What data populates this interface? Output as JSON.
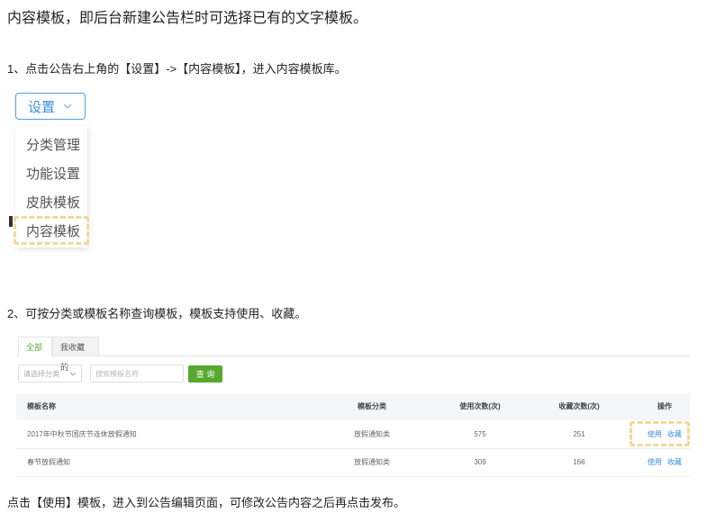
{
  "intro": "内容模板，即后台新建公告栏时可选择已有的文字模板。",
  "step1": "1、点击公告右上角的【设置】->【内容模板】，进入内容模板库。",
  "settings": {
    "button_label": "设置",
    "menu": [
      "分类管理",
      "功能设置",
      "皮肤模板",
      "内容模板"
    ]
  },
  "step2": "2、可按分类或模板名称查询模板，模板支持使用、收藏。",
  "library": {
    "tabs": [
      "全部",
      "我收藏的"
    ],
    "category_select_placeholder": "请选择分类",
    "search_placeholder": "搜索模板名称",
    "query_button": "查 询",
    "columns": [
      "模板名称",
      "模板分类",
      "使用次数(次)",
      "收藏次数(次)",
      "操作"
    ],
    "rows": [
      {
        "name": "2017年中秋节国庆节连休放假通知",
        "category": "放假通知类",
        "uses": "575",
        "favorites": "251",
        "use_link": "使用",
        "fav_link": "收藏"
      },
      {
        "name": "春节放假通知",
        "category": "放假通知类",
        "uses": "309",
        "favorites": "166",
        "use_link": "使用",
        "fav_link": "收藏"
      }
    ]
  },
  "final": "点击【使用】模板，进入到公告编辑页面，可修改公告内容之后再点击发布。",
  "colors": {
    "accent_blue": "#3a8fd9",
    "accent_green": "#58a82f",
    "highlight": "#f3d89a"
  }
}
